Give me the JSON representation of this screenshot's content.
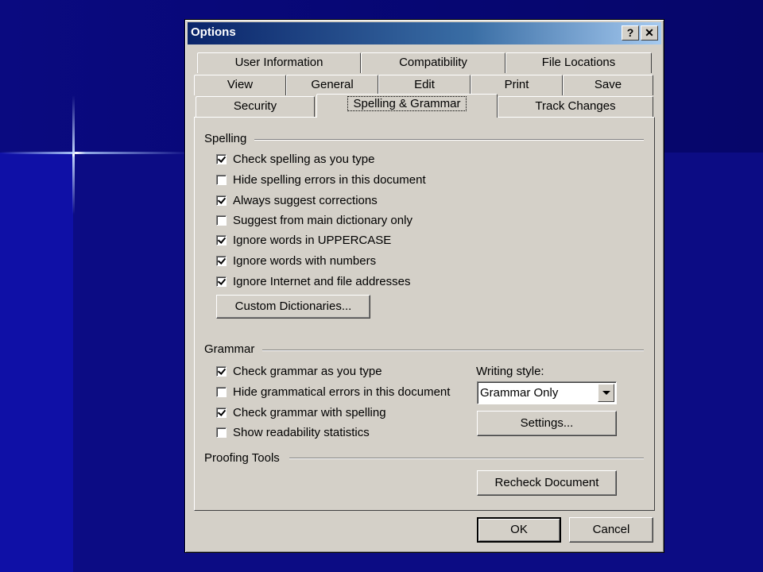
{
  "window": {
    "title": "Options",
    "help_glyph": "?",
    "close_glyph": "✕"
  },
  "tabs_row1": [
    "User Information",
    "Compatibility",
    "File Locations"
  ],
  "tabs_row2": [
    "View",
    "General",
    "Edit",
    "Print",
    "Save"
  ],
  "tabs_row3": [
    "Security",
    "Spelling & Grammar",
    "Track Changes"
  ],
  "active_tab": "Spelling & Grammar",
  "spelling": {
    "label": "Spelling",
    "options": [
      {
        "label": "Check spelling as you type",
        "checked": true
      },
      {
        "label": "Hide spelling errors in this document",
        "checked": false
      },
      {
        "label": "Always suggest corrections",
        "checked": true
      },
      {
        "label": "Suggest from main dictionary only",
        "checked": false
      },
      {
        "label": "Ignore words in UPPERCASE",
        "checked": true
      },
      {
        "label": "Ignore words with numbers",
        "checked": true
      },
      {
        "label": "Ignore Internet and file addresses",
        "checked": true
      }
    ],
    "custom_dictionaries_button": "Custom Dictionaries..."
  },
  "grammar": {
    "label": "Grammar",
    "options": [
      {
        "label": "Check grammar as you type",
        "checked": true
      },
      {
        "label": "Hide grammatical errors in this document",
        "checked": false
      },
      {
        "label": "Check grammar with spelling",
        "checked": true
      },
      {
        "label": "Show readability statistics",
        "checked": false
      }
    ],
    "writing_style_label": "Writing style:",
    "writing_style_value": "Grammar Only",
    "settings_button": "Settings..."
  },
  "proofing_tools": {
    "label": "Proofing Tools",
    "recheck_button": "Recheck Document"
  },
  "footer": {
    "ok": "OK",
    "cancel": "Cancel"
  }
}
